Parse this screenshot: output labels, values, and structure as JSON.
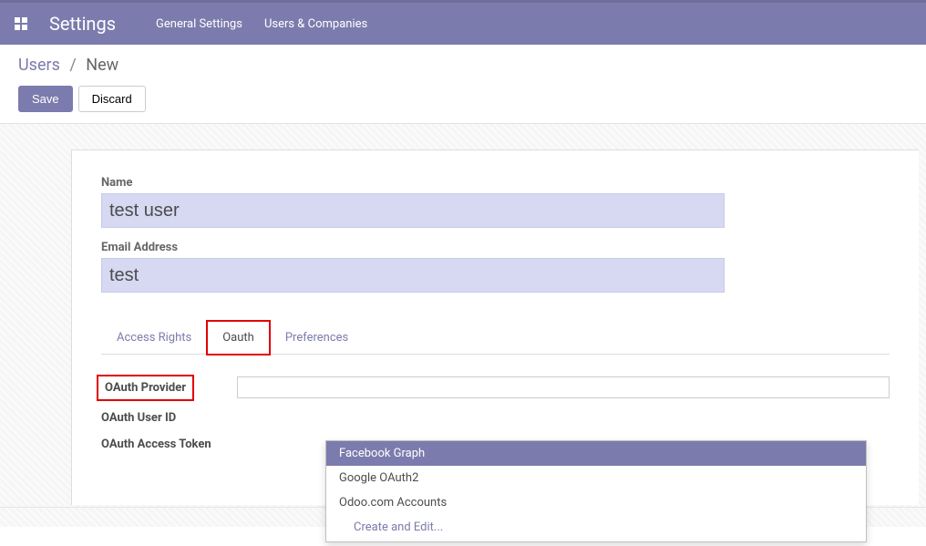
{
  "navbar": {
    "title": "Settings",
    "links": [
      "General Settings",
      "Users & Companies"
    ]
  },
  "breadcrumb": {
    "link": "Users",
    "current": "New"
  },
  "buttons": {
    "save": "Save",
    "discard": "Discard"
  },
  "form": {
    "name_label": "Name",
    "name_value": "test user",
    "email_label": "Email Address",
    "email_value": "test"
  },
  "tabs": {
    "access_rights": "Access Rights",
    "oauth": "Oauth",
    "preferences": "Preferences"
  },
  "oauth_fields": {
    "provider_label": "OAuth Provider",
    "user_id_label": "OAuth User ID",
    "access_token_label": "OAuth Access Token"
  },
  "dropdown": {
    "items": [
      "Facebook Graph",
      "Google OAuth2",
      "Odoo.com Accounts"
    ],
    "action": "Create and Edit..."
  }
}
